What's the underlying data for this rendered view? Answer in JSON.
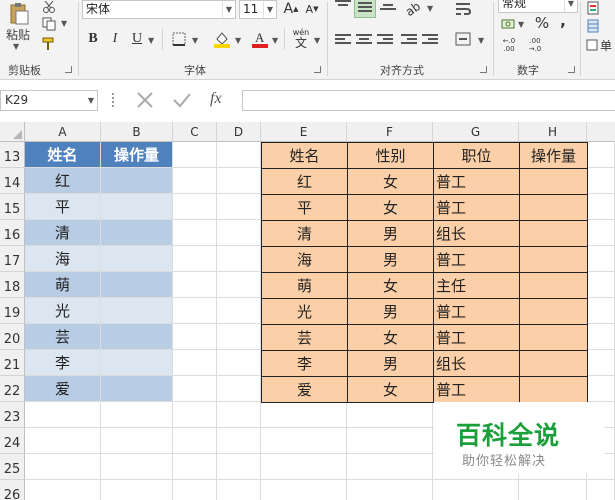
{
  "ribbon": {
    "clipboard": {
      "paste_label": "粘贴",
      "group_label": "剪贴板"
    },
    "font": {
      "font_name": "宋体",
      "font_size": "11",
      "bold": "B",
      "italic": "I",
      "underline": "U",
      "phonetic_label": "wén",
      "group_label": "字体",
      "font_color": "#e02020",
      "fill_color": "#ffd400"
    },
    "alignment": {
      "group_label": "对齐方式"
    },
    "number": {
      "format": "常规",
      "percent": "%",
      "comma": ",",
      "group_label": "数字"
    },
    "cell_style_partial": "单"
  },
  "formula_bar": {
    "name_box": "K29",
    "fx_label": "fx",
    "formula": ""
  },
  "grid": {
    "columns": [
      "A",
      "B",
      "C",
      "D",
      "E",
      "F",
      "G",
      "H"
    ],
    "rows": [
      "13",
      "14",
      "15",
      "16",
      "17",
      "18",
      "19",
      "20",
      "21",
      "22",
      "23",
      "24",
      "25",
      "26"
    ],
    "left_table": {
      "headers": [
        "姓名",
        "操作量"
      ],
      "names": [
        "红",
        "平",
        "清",
        "海",
        "萌",
        "光",
        "芸",
        "李",
        "爱"
      ]
    },
    "right_table": {
      "headers": [
        "姓名",
        "性别",
        "职位",
        "操作量"
      ],
      "rows": [
        [
          "红",
          "女",
          "普工",
          ""
        ],
        [
          "平",
          "女",
          "普工",
          ""
        ],
        [
          "清",
          "男",
          "组长",
          ""
        ],
        [
          "海",
          "男",
          "普工",
          ""
        ],
        [
          "萌",
          "女",
          "主任",
          ""
        ],
        [
          "光",
          "男",
          "普工",
          ""
        ],
        [
          "芸",
          "女",
          "普工",
          ""
        ],
        [
          "李",
          "男",
          "组长",
          ""
        ],
        [
          "爱",
          "女",
          "普工",
          ""
        ]
      ]
    }
  },
  "watermark": {
    "logo": "百科全说",
    "subtitle": "助你轻松解决"
  },
  "colors": {
    "header_blue": "#4f81bd",
    "band_dark": "#b8cce4",
    "band_light": "#dce6f1",
    "peach": "#fbcfa7",
    "watermark_green": "#1b9f3a"
  }
}
